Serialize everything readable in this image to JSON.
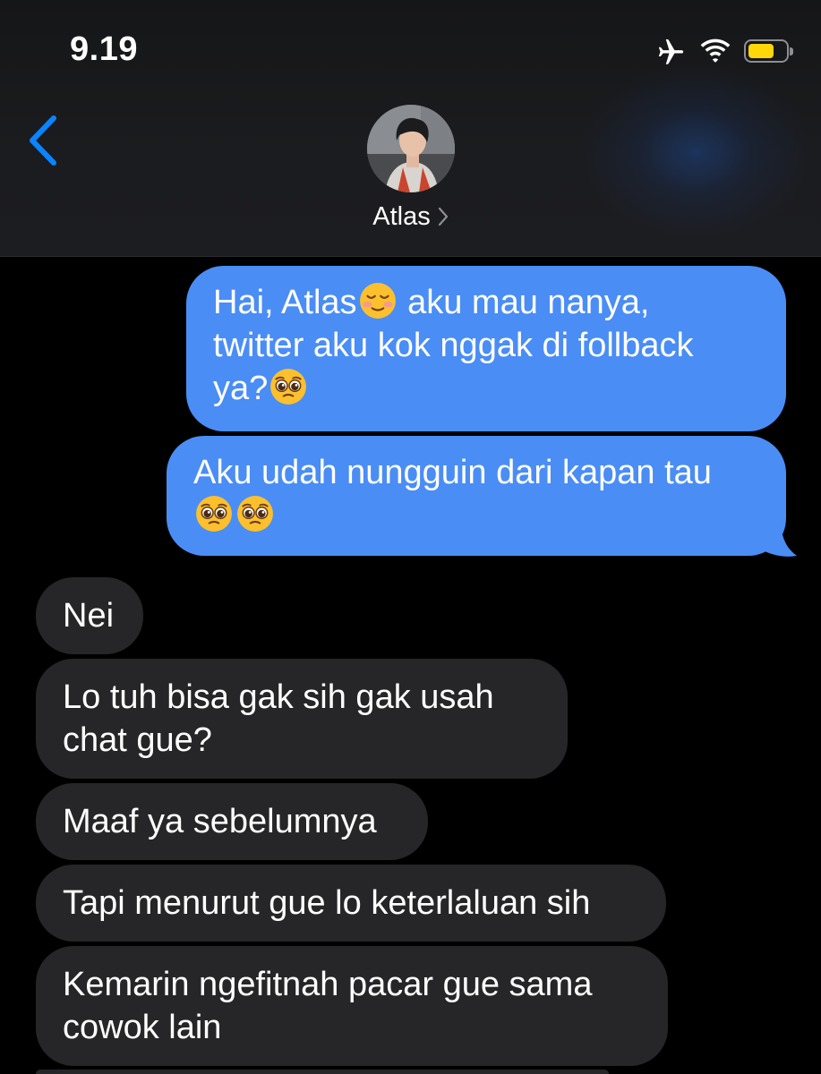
{
  "status_bar": {
    "time": "9.19",
    "icons": [
      "airplane-icon",
      "wifi-icon",
      "battery-icon"
    ],
    "battery_level": 0.7,
    "battery_color": "#ffd60a"
  },
  "header": {
    "back_icon": "chevron-left-icon",
    "contact_name": "Atlas",
    "chevron_icon": "chevron-right-icon"
  },
  "colors": {
    "outgoing_bubble": "#4a8df5",
    "incoming_bubble": "#262628",
    "accent_blue": "#0a84ff"
  },
  "messages": [
    {
      "direction": "outgoing",
      "lines": [
        [
          {
            "text": "Hai, Atlas"
          },
          {
            "emoji": "smiling-face-icon"
          },
          {
            "text": " aku mau nanya,"
          }
        ],
        [
          {
            "text": "twitter aku kok nggak di follback"
          }
        ],
        [
          {
            "text": "ya?"
          },
          {
            "emoji": "pleading-face-icon"
          }
        ]
      ]
    },
    {
      "direction": "outgoing",
      "lines": [
        [
          {
            "text": "Aku udah nungguin dari kapan tau"
          }
        ],
        [
          {
            "emoji": "pleading-face-icon"
          },
          {
            "emoji": "pleading-face-icon"
          }
        ]
      ]
    },
    {
      "direction": "incoming",
      "lines": [
        [
          {
            "text": "Nei"
          }
        ]
      ]
    },
    {
      "direction": "incoming",
      "lines": [
        [
          {
            "text": "Lo tuh bisa gak sih gak usah"
          }
        ],
        [
          {
            "text": "chat gue?"
          }
        ]
      ]
    },
    {
      "direction": "incoming",
      "lines": [
        [
          {
            "text": "Maaf ya sebelumnya"
          }
        ]
      ]
    },
    {
      "direction": "incoming",
      "lines": [
        [
          {
            "text": "Tapi menurut gue lo keterlaluan sih"
          }
        ]
      ]
    },
    {
      "direction": "incoming",
      "lines": [
        [
          {
            "text": "Kemarin ngefitnah pacar gue sama"
          }
        ],
        [
          {
            "text": "cowok lain"
          }
        ]
      ]
    }
  ]
}
